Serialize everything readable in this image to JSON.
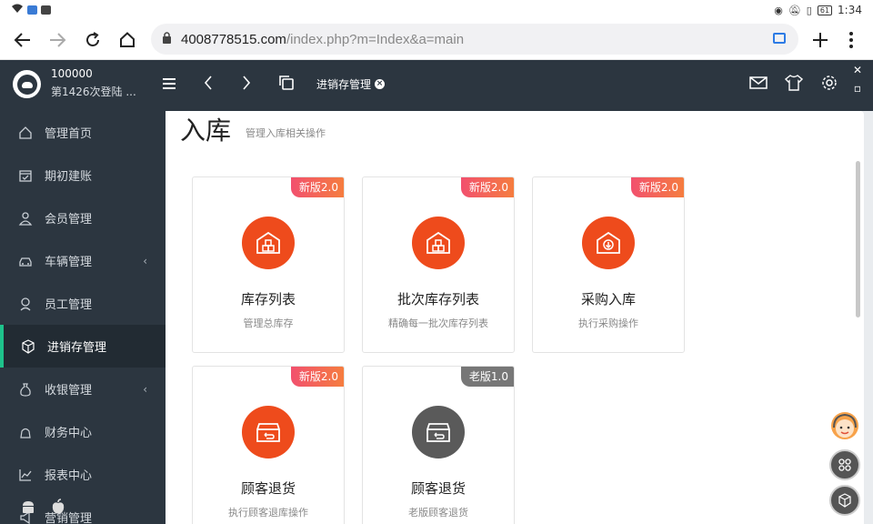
{
  "status_bar": {
    "time": "1:34",
    "battery": "61"
  },
  "browser": {
    "url_host": "4008778515.com",
    "url_path": "/index.php?m=Index&a=main"
  },
  "header": {
    "user_id": "100000",
    "login_info": "第1426次登陆 ...",
    "active_tab": "进销存管理"
  },
  "sidebar": {
    "items": [
      {
        "label": "管理首页",
        "icon": "home-icon",
        "chevron": ""
      },
      {
        "label": "期初建账",
        "icon": "calendar-check-icon",
        "chevron": ""
      },
      {
        "label": "会员管理",
        "icon": "user-icon",
        "chevron": ""
      },
      {
        "label": "车辆管理",
        "icon": "car-icon",
        "chevron": "‹"
      },
      {
        "label": "员工管理",
        "icon": "staff-icon",
        "chevron": ""
      },
      {
        "label": "进销存管理",
        "icon": "box-icon",
        "chevron": ""
      },
      {
        "label": "收银管理",
        "icon": "money-bag-icon",
        "chevron": "‹"
      },
      {
        "label": "财务中心",
        "icon": "finance-icon",
        "chevron": ""
      },
      {
        "label": "报表中心",
        "icon": "chart-line-icon",
        "chevron": ""
      },
      {
        "label": "营销管理",
        "icon": "marketing-icon",
        "chevron": ""
      }
    ]
  },
  "page": {
    "title": "入库",
    "subtitle": "管理入库相关操作"
  },
  "cards": [
    {
      "badge": "新版2.0",
      "title": "库存列表",
      "desc": "管理总库存",
      "icon": "warehouse-icon"
    },
    {
      "badge": "新版2.0",
      "title": "批次库存列表",
      "desc": "精确每一批次库存列表",
      "icon": "warehouse-icon"
    },
    {
      "badge": "新版2.0",
      "title": "采购入库",
      "desc": "执行采购操作",
      "icon": "house-download-icon"
    },
    {
      "badge": "新版2.0",
      "title": "顾客退货",
      "desc": "执行顾客退库操作",
      "icon": "return-box-icon"
    },
    {
      "badge": "老版1.0",
      "title": "顾客退货",
      "desc": "老版顾客退货",
      "icon": "return-box-icon"
    }
  ],
  "colors": {
    "sidebar_bg": "#2c3640",
    "accent_green": "#1ec28b",
    "card_icon_orange": "#ee4b1c",
    "card_icon_gray": "#5a5a5a",
    "badge_new": "#f2506e",
    "badge_old": "#777777"
  }
}
